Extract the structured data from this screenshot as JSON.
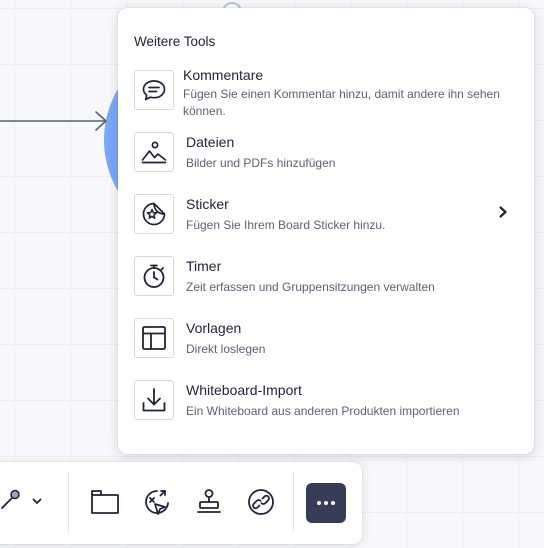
{
  "menu": {
    "title": "Weitere Tools",
    "items": [
      {
        "title": "Kommentare",
        "description": "Fügen Sie einen Kommentar hinzu, damit andere ihn sehen können.",
        "icon": "comment-icon"
      },
      {
        "title": "Dateien",
        "description": "Bilder und PDFs hinzufügen",
        "icon": "image-icon"
      },
      {
        "title": "Sticker",
        "description": "Fügen Sie Ihrem Board Sticker hinzu.",
        "icon": "sticker-icon",
        "has_submenu": true
      },
      {
        "title": "Timer",
        "description": "Zeit erfassen und Gruppensitzungen verwalten",
        "icon": "timer-icon"
      },
      {
        "title": "Vorlagen",
        "description": "Direkt loslegen",
        "icon": "template-icon"
      },
      {
        "title": "Whiteboard-Import",
        "description": "Ein Whiteboard aus anderen Produkten importieren",
        "icon": "download-icon"
      }
    ]
  },
  "toolbar": {
    "buttons": [
      "pen-icon",
      "chevron-down-icon",
      "frame-icon",
      "reactions-icon",
      "stamp-icon",
      "link-icon",
      "more-icon"
    ],
    "active": "more-icon"
  },
  "colors": {
    "accent_dark": "#363d57",
    "canvas_shape": "#7aa8f7",
    "text_primary": "#1f2337",
    "text_secondary": "#5d6274"
  }
}
